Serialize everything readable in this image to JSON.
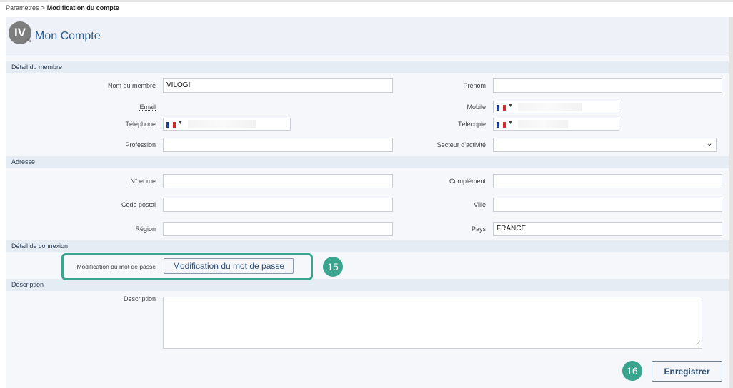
{
  "breadcrumb": {
    "parent": "Paramètres",
    "separator": ">",
    "current": "Modification du compte"
  },
  "header": {
    "avatar_initials": "IV",
    "title": "Mon Compte"
  },
  "sections": {
    "member": "Détail du membre",
    "address": "Adresse",
    "login": "Détail de connexion",
    "description": "Description"
  },
  "member": {
    "name_label": "Nom du membre",
    "name_value": "VILOGI",
    "firstname_label": "Prénom",
    "firstname_value": "",
    "email_label": "Email",
    "mobile_label": "Mobile",
    "phone_label": "Téléphone",
    "fax_label": "Télécopie",
    "profession_label": "Profession",
    "profession_value": "",
    "sector_label": "Secteur d'activité",
    "sector_value": ""
  },
  "address": {
    "street_label": "N° et rue",
    "street_value": "",
    "complement_label": "Complément",
    "complement_value": "",
    "zip_label": "Code postal",
    "zip_value": "",
    "city_label": "Ville",
    "city_value": "",
    "region_label": "Région",
    "region_value": "",
    "country_label": "Pays",
    "country_value": "FRANCE"
  },
  "login": {
    "password_label": "Modification du mot de passe",
    "password_button": "Modification du mot de passe"
  },
  "description": {
    "label": "Description",
    "value": ""
  },
  "actions": {
    "save_label": "Enregistrer"
  },
  "annotations": {
    "step_15": "15",
    "step_16": "16"
  },
  "colors": {
    "accent": "#3aa58f",
    "title": "#2f5d8c",
    "section_bg": "#e6ecf4"
  },
  "icons": {
    "edit": "edit-icon",
    "select": "chevron-down-icon",
    "flag": "france-flag-icon"
  }
}
